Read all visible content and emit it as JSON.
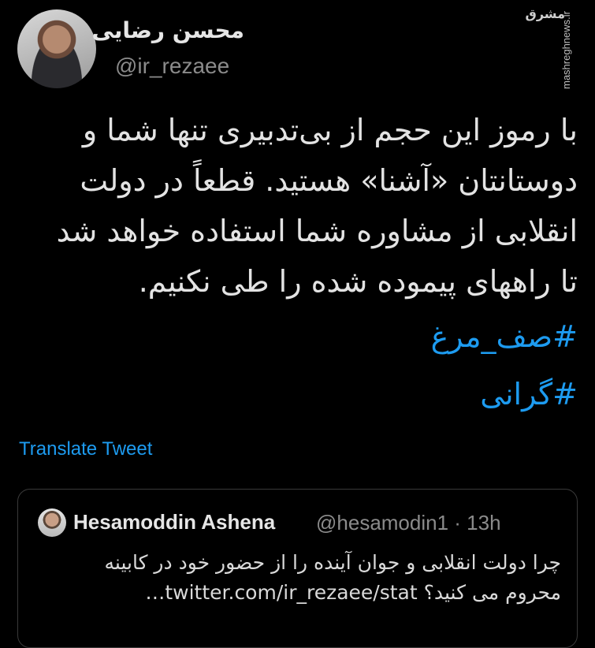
{
  "author": {
    "display_name": "محسن رضایی",
    "handle": "@ir_rezaee"
  },
  "watermark": {
    "logo": "مشرق",
    "url": "mashreghnews.ir"
  },
  "tweet": {
    "text": "با رموز این حجم از بی‌تدبیری تنها شما و\nدوستانتان «آشنا» هستید. قطعاً در دولت\nانقلابی از مشاوره شما استفاده خواهد شد\nتا راههای پیموده شده را طی نکنیم.",
    "hashtags": [
      "#صف_مرغ",
      "#گرانی"
    ],
    "translate_label": "Translate Tweet"
  },
  "quoted": {
    "name": "Hesamoddin Ashena",
    "handle_time": "@hesamodin1 · 13h",
    "text_line1": "چرا دولت انقلابی و جوان آینده را از حضور خود در کابینه",
    "text_line2": "محروم می کنید؟ twitter.com/ir_rezaee/stat…"
  }
}
